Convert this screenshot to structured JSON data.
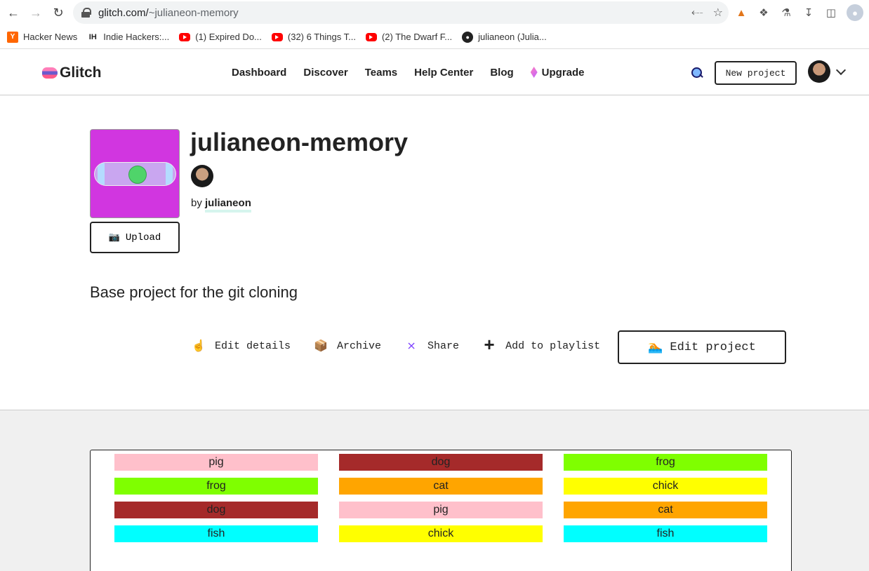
{
  "browser": {
    "url_host": "glitch.com/",
    "url_path": "~julianeon-memory",
    "bookmarks": [
      {
        "label": "Hacker News",
        "icon": "hn"
      },
      {
        "label": "Indie Hackers:...",
        "icon": "ih"
      },
      {
        "label": "(1) Expired Do...",
        "icon": "yt"
      },
      {
        "label": "(32) 6 Things T...",
        "icon": "yt"
      },
      {
        "label": "(2) The Dwarf F...",
        "icon": "yt"
      },
      {
        "label": "julianeon (Julia...",
        "icon": "gh"
      }
    ]
  },
  "header": {
    "logo_text": "Glitch",
    "nav": [
      "Dashboard",
      "Discover",
      "Teams",
      "Help Center",
      "Blog",
      "Upgrade"
    ],
    "new_project_label": "New project"
  },
  "project": {
    "title": "julianeon-memory",
    "by_label": "by",
    "owner": "julianeon",
    "upload_label": "Upload",
    "description": "Base project for the git cloning",
    "actions": {
      "edit_details": "Edit details",
      "archive": "Archive",
      "share": "Share",
      "add_to_playlist": "Add to playlist",
      "edit_project": "Edit project"
    },
    "avatar_colors": {
      "background": "#d136e0",
      "dot": "#4fd46a"
    }
  },
  "preview": {
    "tiles": [
      {
        "label": "pig",
        "color": "#ffc0cb"
      },
      {
        "label": "dog",
        "color": "#a52a2a"
      },
      {
        "label": "frog",
        "color": "#7fff00"
      },
      {
        "label": "frog",
        "color": "#7fff00"
      },
      {
        "label": "cat",
        "color": "#ffa500"
      },
      {
        "label": "chick",
        "color": "#ffff00"
      },
      {
        "label": "dog",
        "color": "#a52a2a"
      },
      {
        "label": "pig",
        "color": "#ffc0cb"
      },
      {
        "label": "cat",
        "color": "#ffa500"
      },
      {
        "label": "fish",
        "color": "#00ffff"
      },
      {
        "label": "chick",
        "color": "#ffff00"
      },
      {
        "label": "fish",
        "color": "#00ffff"
      }
    ]
  }
}
